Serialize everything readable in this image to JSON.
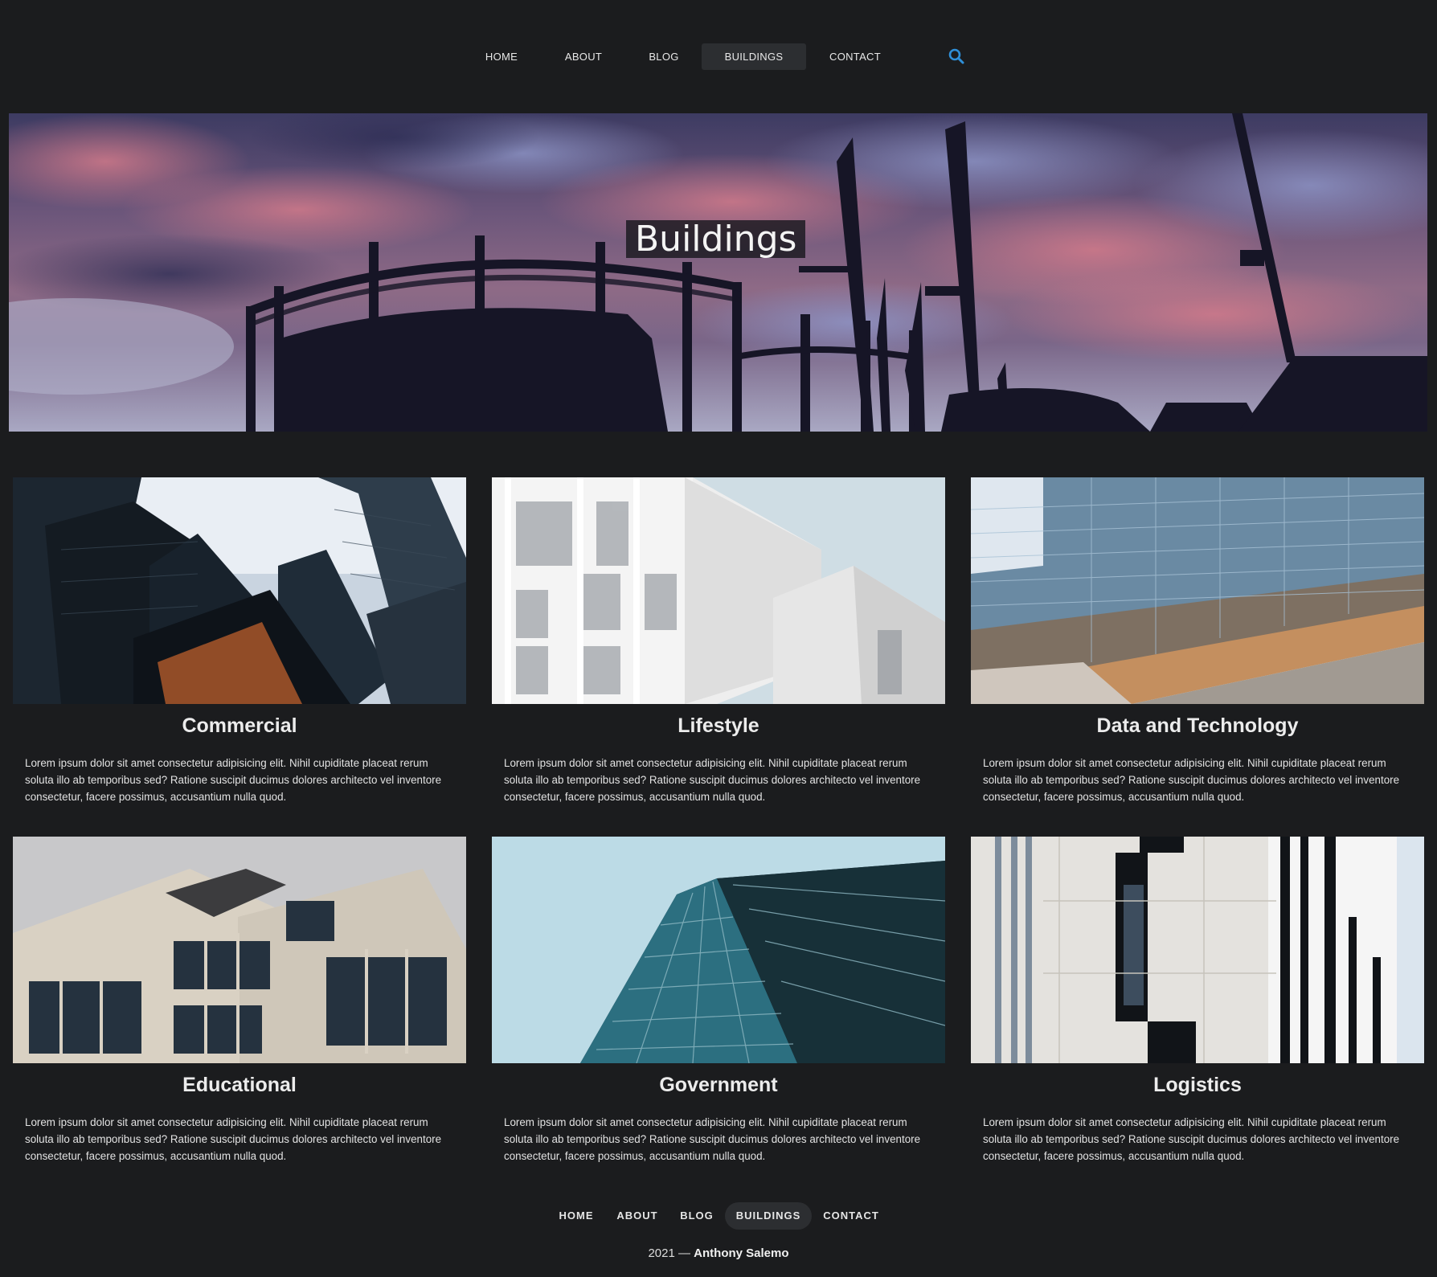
{
  "nav": {
    "items": [
      {
        "label": "HOME"
      },
      {
        "label": "ABOUT"
      },
      {
        "label": "BLOG"
      },
      {
        "label": "BUILDINGS"
      },
      {
        "label": "CONTACT"
      }
    ],
    "active": "BUILDINGS",
    "search_icon": "search-icon",
    "accent_color": "#2f8fd8"
  },
  "hero": {
    "title": "Buildings"
  },
  "cards": [
    {
      "title": "Commercial",
      "text": "Lorem ipsum dolor sit amet consectetur adipisicing elit. Nihil cupiditate placeat rerum soluta illo ab temporibus sed? Ratione suscipit ducimus dolores architecto vel inventore consectetur, facere possimus, accusantium nulla quod."
    },
    {
      "title": "Lifestyle",
      "text": "Lorem ipsum dolor sit amet consectetur adipisicing elit. Nihil cupiditate placeat rerum soluta illo ab temporibus sed? Ratione suscipit ducimus dolores architecto vel inventore consectetur, facere possimus, accusantium nulla quod."
    },
    {
      "title": "Data and Technology",
      "text": "Lorem ipsum dolor sit amet consectetur adipisicing elit. Nihil cupiditate placeat rerum soluta illo ab temporibus sed? Ratione suscipit ducimus dolores architecto vel inventore consectetur, facere possimus, accusantium nulla quod."
    },
    {
      "title": "Educational",
      "text": "Lorem ipsum dolor sit amet consectetur adipisicing elit. Nihil cupiditate placeat rerum soluta illo ab temporibus sed? Ratione suscipit ducimus dolores architecto vel inventore consectetur, facere possimus, accusantium nulla quod."
    },
    {
      "title": "Government",
      "text": "Lorem ipsum dolor sit amet consectetur adipisicing elit. Nihil cupiditate placeat rerum soluta illo ab temporibus sed? Ratione suscipit ducimus dolores architecto vel inventore consectetur, facere possimus, accusantium nulla quod."
    },
    {
      "title": "Logistics",
      "text": "Lorem ipsum dolor sit amet consectetur adipisicing elit. Nihil cupiditate placeat rerum soluta illo ab temporibus sed? Ratione suscipit ducimus dolores architecto vel inventore consectetur, facere possimus, accusantium nulla quod."
    }
  ],
  "footer": {
    "nav": [
      {
        "label": "HOME"
      },
      {
        "label": "ABOUT"
      },
      {
        "label": "BLOG"
      },
      {
        "label": "BUILDINGS"
      },
      {
        "label": "CONTACT"
      }
    ],
    "year": "2021 —",
    "author": "Anthony Salemo"
  }
}
